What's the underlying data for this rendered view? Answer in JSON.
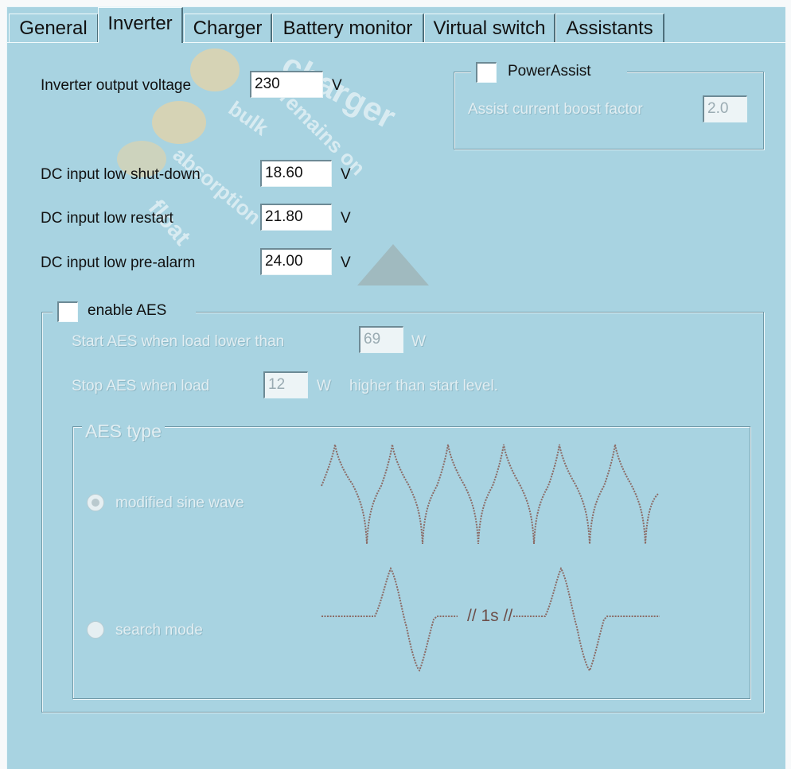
{
  "tabs": [
    "General",
    "Inverter",
    "Charger",
    "Battery monitor",
    "Virtual switch",
    "Assistants"
  ],
  "inverter": {
    "output_voltage_label": "Inverter output voltage",
    "output_voltage_value": "230",
    "output_voltage_unit": "V"
  },
  "dc_input": {
    "shutdown_label": "DC input low shut-down",
    "shutdown_value": "18.60",
    "shutdown_unit": "V",
    "restart_label": "DC input low restart",
    "restart_value": "21.80",
    "restart_unit": "V",
    "prealarm_label": "DC input low pre-alarm",
    "prealarm_value": "24.00",
    "prealarm_unit": "V"
  },
  "power_assist": {
    "label": "PowerAssist",
    "checked": false,
    "boost_label": "Assist current boost factor",
    "boost_value": "2.0"
  },
  "aes": {
    "label": "enable AES",
    "checked": false,
    "start_label": "Start AES when load lower than",
    "start_value": "69",
    "start_unit": "W",
    "stop_label": "Stop AES when load",
    "stop_value": "12",
    "stop_unit": "W",
    "stop_suffix": "higher than start level.",
    "type_legend": "AES type",
    "modified_sine_label": "modified sine wave",
    "search_mode_label": "search mode",
    "selected_type": "modified sine wave",
    "search_pulse_label": "// 1s //"
  },
  "watermark": {
    "words": [
      "charger",
      "remains on",
      "bulk",
      "absorption",
      "float"
    ]
  },
  "colors": {
    "panel_bg": "#a8d3e1",
    "disabled_text": "#e2eef2",
    "field_bg": "#ffffff"
  }
}
